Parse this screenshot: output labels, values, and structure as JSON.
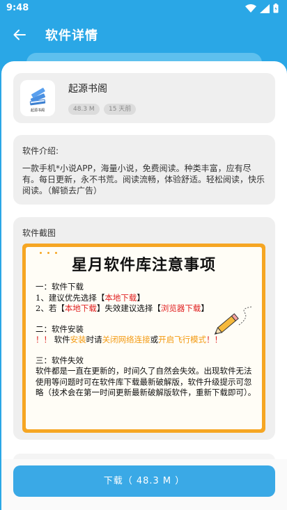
{
  "status_bar": {
    "time": "9:48"
  },
  "header": {
    "title": "软件详情"
  },
  "app": {
    "name": "起源书阁",
    "icon_caption": "起源书阁",
    "size_badge": "48.3 M",
    "time_badge": "15 天前"
  },
  "intro": {
    "label": "软件介绍:",
    "text": "一款手机*小说APP，海量小说，免费阅读。种类丰富，应有尽有。每日更新，永不书荒。阅读流畅，体验舒适。轻松阅读，快乐阅读。（解锁去广告）"
  },
  "screenshots": {
    "label": "软件截图",
    "notice": {
      "title": "星月软件库注意事项",
      "s1_head": "一：软件下载",
      "s1_l1_a": "1、建议优先选择【",
      "s1_l1_red": "本地下载",
      "s1_l1_b": "】",
      "s1_l2_a": "2、若【",
      "s1_l2_red1": "本地下载",
      "s1_l2_b": "】失效建议选择【",
      "s1_l2_red2": "浏览器下载",
      "s1_l2_c": "】",
      "s2_head": "二：软件安装",
      "s2_ex1": "！！",
      "s2_a": "软件",
      "s2_o1": "安装",
      "s2_b": "时请",
      "s2_o2": "关闭网络连接",
      "s2_c": "或",
      "s2_o3": "开启飞行模式",
      "s2_ex2": "！！",
      "s3_head": "三：软件失效",
      "s3_text": "软件都是一直在更新的，时间久了自然会失效。出现软件无法使用等问题时可在软件库下载最新破解版，软件升级提示可忽略（技术会在第一时间更新最新破解版软件，重新下载即可）。"
    }
  },
  "download": {
    "label": "下载（ 48.3 M ）"
  },
  "colors": {
    "primary": "#2aa7e6",
    "button": "#3aa9e6",
    "accent_orange": "#f6a623",
    "accent_red": "#e02020"
  },
  "icons": [
    "wifi-icon",
    "signal-icon",
    "battery-icon",
    "back-arrow-icon",
    "book-stack-icon",
    "pencil-icon"
  ]
}
